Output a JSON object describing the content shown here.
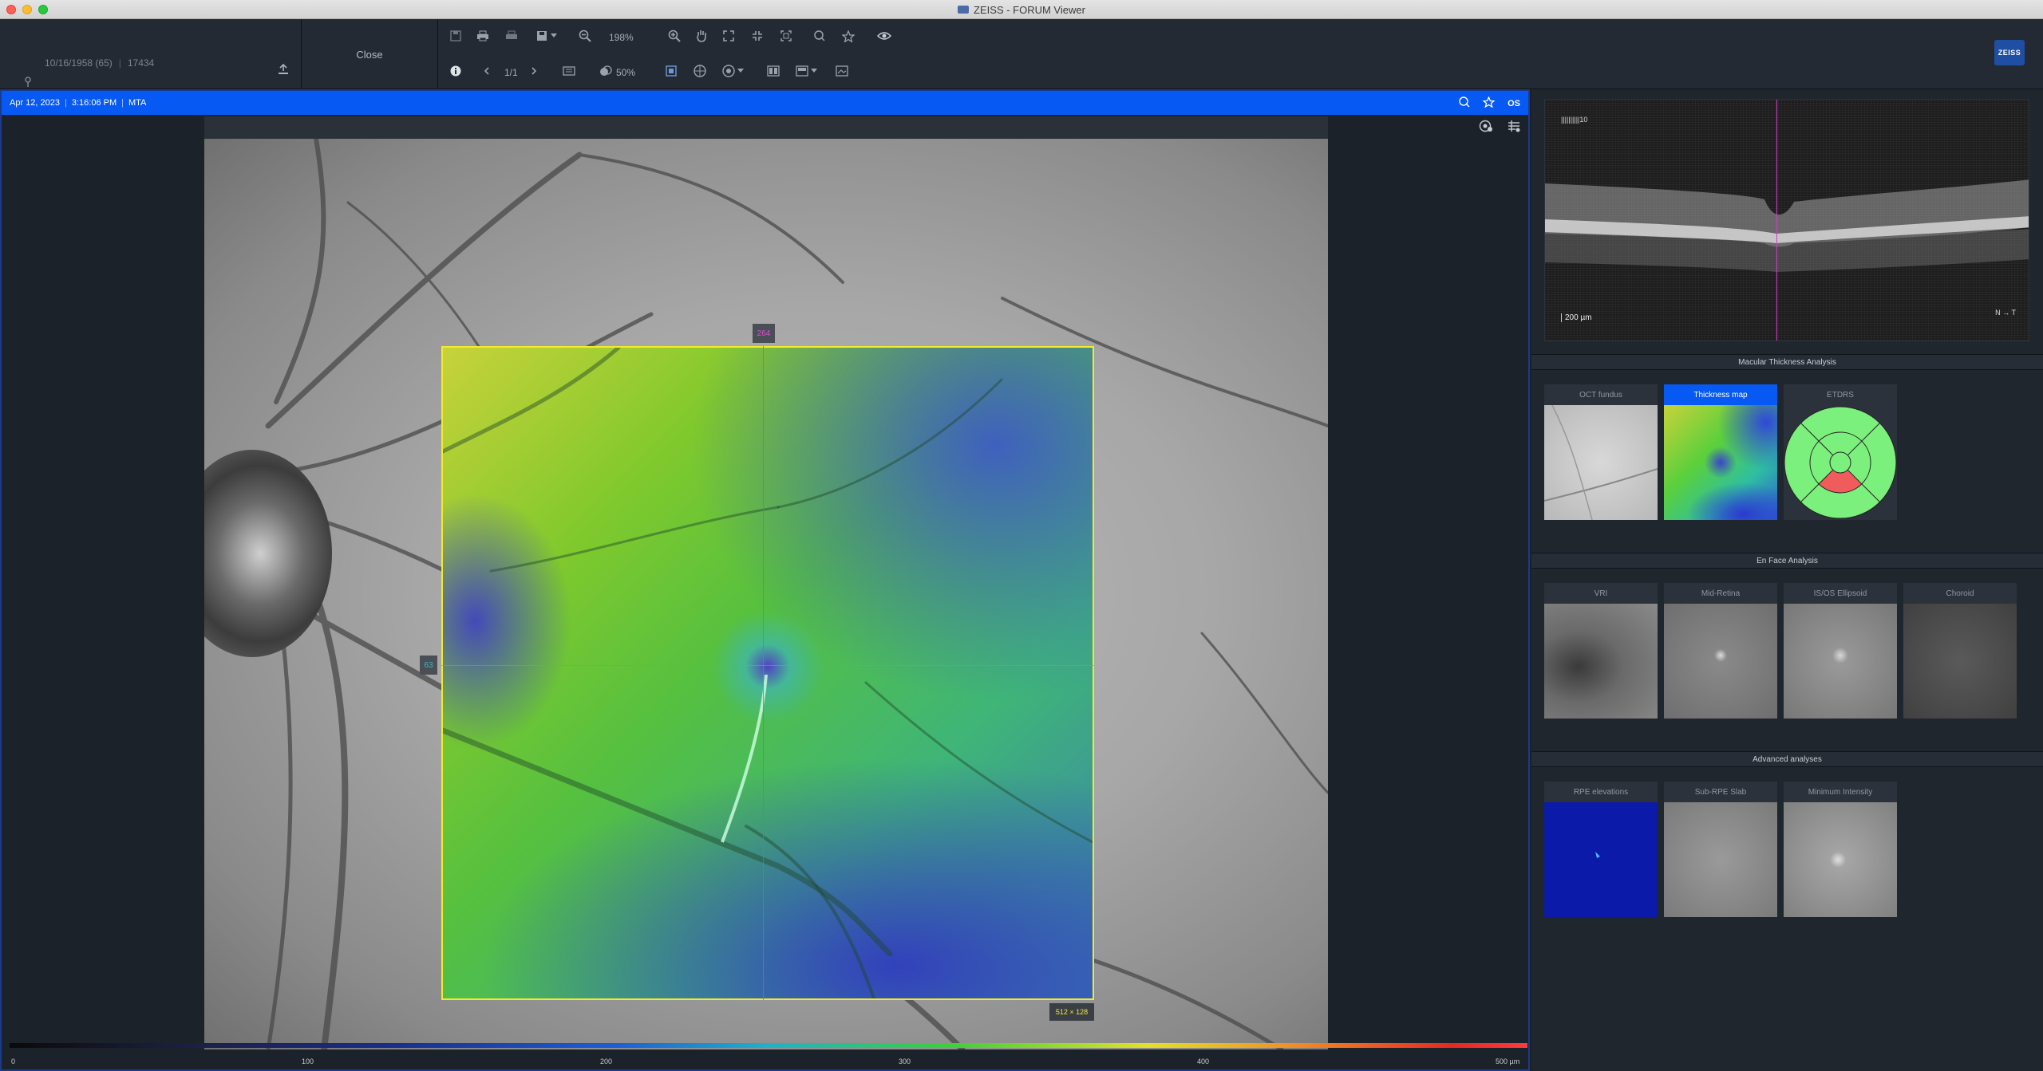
{
  "window": {
    "title": "ZEISS - FORUM Viewer"
  },
  "patient": {
    "dob": "10/16/1958 (65)",
    "id": "17434"
  },
  "toolbar": {
    "close_label": "Close",
    "zoom": "198%",
    "page": "1/1",
    "opacity": "50%"
  },
  "brand": {
    "logo": "ZEISS",
    "accent": "#0759f4"
  },
  "exam": {
    "date": "Apr 12, 2023",
    "time": "3:16:06 PM",
    "type": "MTA",
    "eye": "OS"
  },
  "overlay": {
    "top_marker": "264",
    "left_marker": "63",
    "size": "512 × 128"
  },
  "scale": {
    "labels": [
      "0",
      "100",
      "200",
      "300",
      "400",
      "500 µm"
    ]
  },
  "bscan": {
    "label": "10",
    "scale": "200 µm",
    "orientation_n": "N",
    "orientation_t": "T"
  },
  "sections": {
    "macular": {
      "title": "Macular Thickness Analysis",
      "tiles": [
        "OCT fundus",
        "Thickness map",
        "ETDRS"
      ]
    },
    "enface": {
      "title": "En Face Analysis",
      "tiles": [
        "VRI",
        "Mid-Retina",
        "IS/OS Ellipsoid",
        "Choroid"
      ]
    },
    "advanced": {
      "title": "Advanced analyses",
      "tiles": [
        "RPE elevations",
        "Sub-RPE Slab",
        "Minimum Intensity"
      ]
    }
  }
}
